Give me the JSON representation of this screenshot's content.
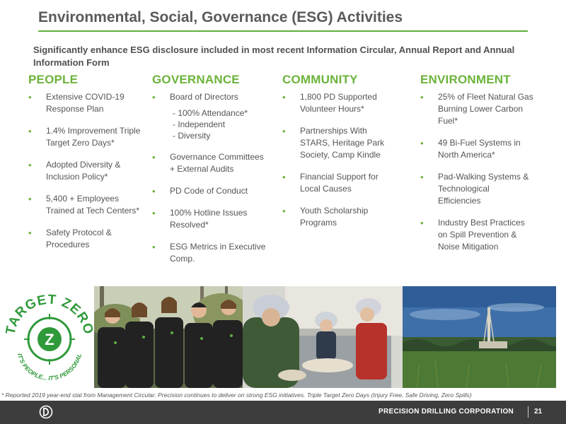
{
  "title": "Environmental, Social, Governance (ESG) Activities",
  "subtitle": "Significantly enhance ESG disclosure included in most recent Information Circular, Annual Report and Annual Information Form",
  "columns": {
    "people": {
      "heading": "PEOPLE",
      "items": [
        "Extensive COVID-19 Response Plan",
        "1.4% Improvement Triple Target Zero Days*",
        "Adopted Diversity & Inclusion Policy*",
        "5,400 + Employees Trained at Tech Centers*",
        "Safety Protocol & Procedures"
      ]
    },
    "governance": {
      "heading": "GOVERNANCE",
      "items": [
        "Board of Directors",
        "Governance Committees + External Audits",
        "PD Code of Conduct",
        "100% Hotline Issues Resolved*",
        "ESG Metrics in Executive Comp."
      ],
      "board_subitems": [
        "- 100% Attendance*",
        "- Independent",
        "- Diversity"
      ]
    },
    "community": {
      "heading": "COMMUNITY",
      "items": [
        "1,800 PD Supported Volunteer Hours*",
        "Partnerships With STARS, Heritage Park Society, Camp Kindle",
        "Financial Support for Local Causes",
        "Youth Scholarship Programs"
      ]
    },
    "environment": {
      "heading": "ENVIRONMENT",
      "items": [
        "25% of Fleet Natural Gas Burning Lower Carbon Fuel*",
        "49 Bi-Fuel Systems in North America*",
        "Pad-Walking Systems & Technological Efficiencies",
        "Industry Best Practices on Spill Prevention & Noise Mitigation"
      ]
    }
  },
  "logo": {
    "top_text": "TARGET ZERO",
    "center_letter": "Z",
    "bottom_text": "IT'S PEOPLE... IT'S PERSONAL"
  },
  "footnote": "* Reported 2019 year-end stat from Management Circular. Precision continues to deliver on strong ESG initiatives. Triple Target Zero Days (Injury Free, Safe Driving, Zero Spills)",
  "footer": {
    "company": "PRECISION DRILLING CORPORATION",
    "page": "21"
  },
  "colors": {
    "accent_green": "#6bb33a",
    "footer_bg": "#3d3d3d",
    "title_gray": "#5a5a5a"
  }
}
